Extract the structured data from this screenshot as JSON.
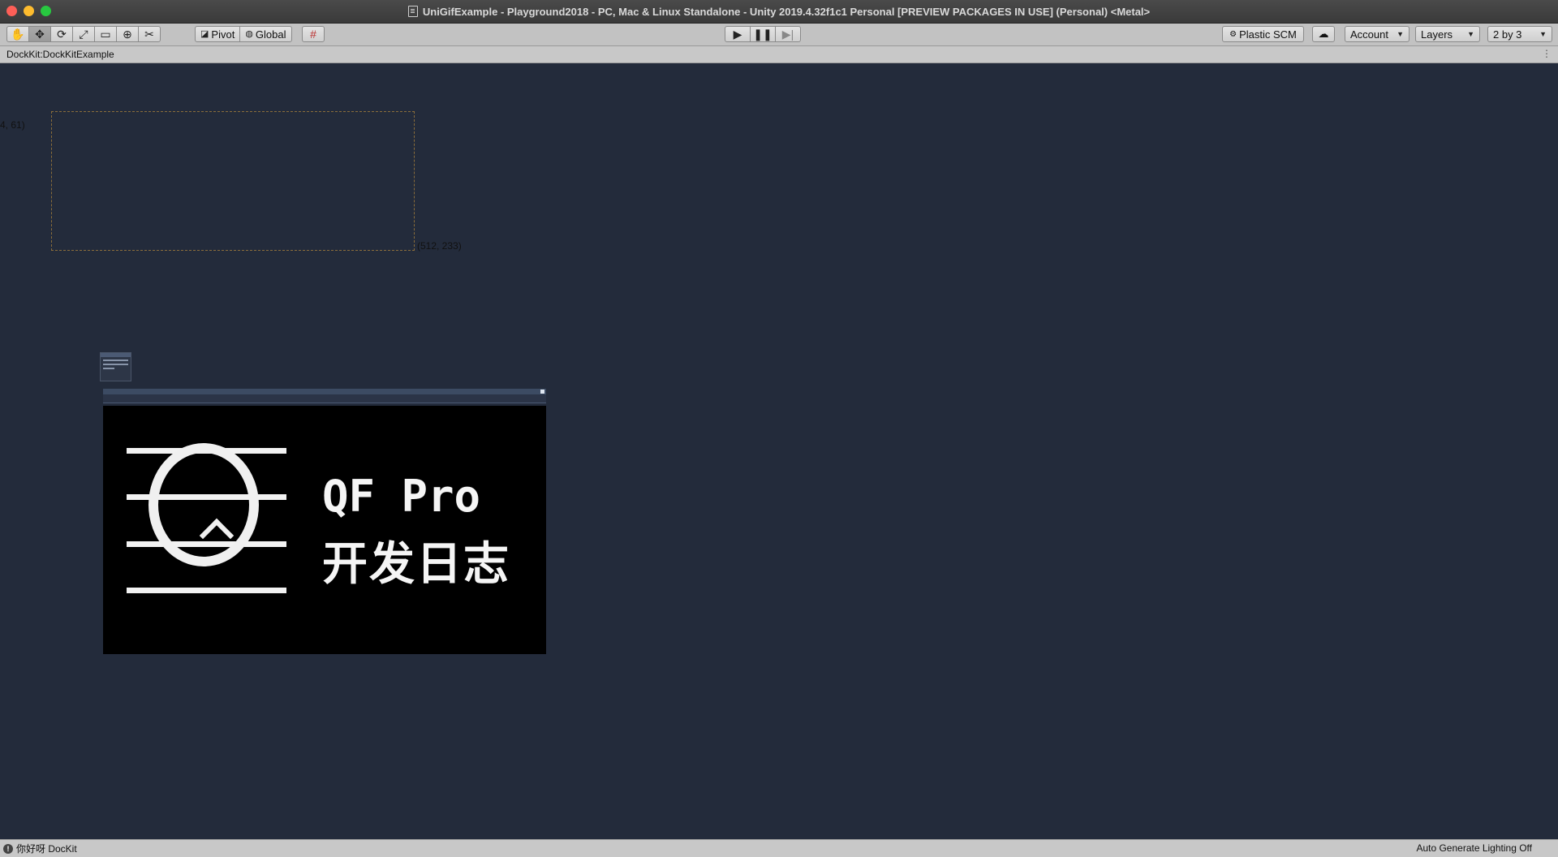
{
  "window": {
    "title": "UniGifExample - Playground2018 - PC, Mac & Linux Standalone - Unity 2019.4.32f1c1 Personal [PREVIEW PACKAGES IN USE] (Personal) <Metal>"
  },
  "toolbar": {
    "pivot_label": "Pivot",
    "global_label": "Global",
    "plastic_label": "Plastic SCM",
    "account_label": "Account",
    "layers_label": "Layers",
    "layout_label": "2 by 3"
  },
  "tab": {
    "label": "DockKit:DockKitExample"
  },
  "scene": {
    "coord_top_left": "4, 61)",
    "coord_bottom_right": "(512, 233)",
    "gif_title": "QF Pro",
    "gif_subtitle": "开发日志"
  },
  "status": {
    "message": "你好呀 DocKit",
    "right": "Auto Generate Lighting Off"
  }
}
